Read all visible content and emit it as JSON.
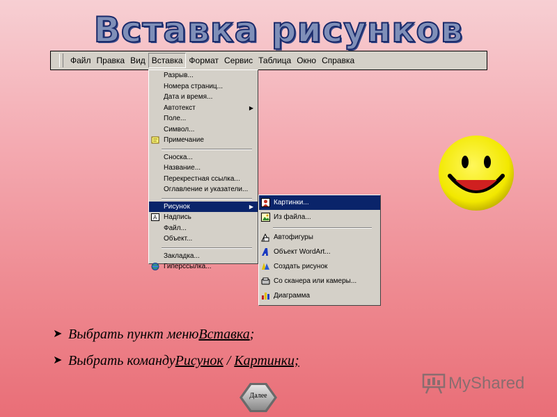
{
  "title": "Вставка рисунков",
  "menubar": [
    "Файл",
    "Правка",
    "Вид",
    "Вставка",
    "Формат",
    "Сервис",
    "Таблица",
    "Окно",
    "Справка"
  ],
  "insert_menu": {
    "items": [
      "Разрыв...",
      "Номера страниц...",
      "Дата и время...",
      "Автотекст",
      "Поле...",
      "Символ...",
      "Примечание"
    ],
    "items2": [
      "Сноска...",
      "Название...",
      "Перекрестная ссылка...",
      "Оглавление и указатели..."
    ],
    "items3": [
      "Рисунок",
      "Надпись",
      "Файл...",
      "Объект..."
    ],
    "items4": [
      "Закладка...",
      "Гиперссылка..."
    ]
  },
  "picture_submenu": {
    "items": [
      "Картинки...",
      "Из файла..."
    ],
    "items2": [
      "Автофигуры",
      "Объект WordArt...",
      "Создать рисунок",
      "Со сканера или камеры...",
      "Диаграмма"
    ]
  },
  "bullets": {
    "line1": {
      "prefix": "Выбрать пункт меню ",
      "link": "Вставка",
      "suffix": ";"
    },
    "line2": {
      "prefix": "Выбрать команду ",
      "link1": "Рисунок",
      "sep": " / ",
      "link2": "Картинки;"
    }
  },
  "next_button": "Далее",
  "watermark": "MyShared",
  "colors": {
    "highlight": "#0a246a",
    "menu_bg": "#d4d0c8",
    "title_fill": "#7f8fb8",
    "smiley": "#f2e800"
  },
  "icons": [
    "bullet-arrow-icon",
    "clipart-icon",
    "image-file-icon",
    "autoshapes-icon",
    "wordart-icon",
    "draw-icon",
    "scanner-icon",
    "chart-icon",
    "note-icon",
    "textbox-icon",
    "hyperlink-icon",
    "smiley-icon"
  ]
}
